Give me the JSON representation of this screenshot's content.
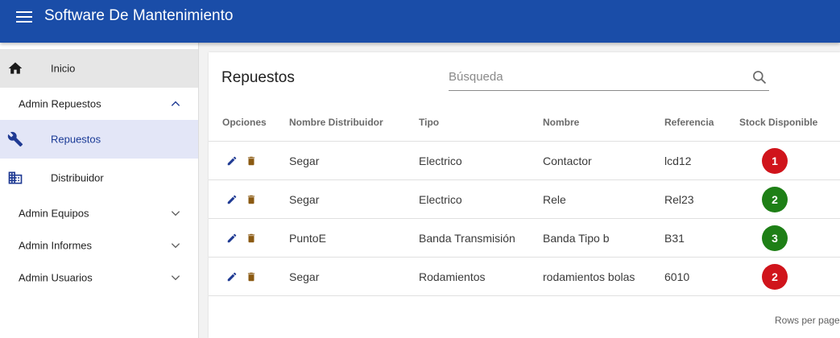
{
  "app": {
    "title": "Software De Mantenimiento"
  },
  "sidebar": {
    "inicio": "Inicio",
    "admin_repuestos": "Admin Repuestos",
    "repuestos": "Repuestos",
    "distribuidor": "Distribuidor",
    "admin_equipos": "Admin Equipos",
    "admin_informes": "Admin Informes",
    "admin_usuarios": "Admin Usuarios"
  },
  "main": {
    "title": "Repuestos",
    "search_placeholder": "Búsqueda"
  },
  "table": {
    "headers": {
      "opciones": "Opciones",
      "distribuidor": "Nombre Distribuidor",
      "tipo": "Tipo",
      "nombre": "Nombre",
      "referencia": "Referencia",
      "stock": "Stock Disponible"
    },
    "rows": [
      {
        "distribuidor": "Segar",
        "tipo": "Electrico",
        "nombre": "Contactor",
        "referencia": "lcd12",
        "stock": "1",
        "stock_color": "#d0141b"
      },
      {
        "distribuidor": "Segar",
        "tipo": "Electrico",
        "nombre": "Rele",
        "referencia": "Rel23",
        "stock": "2",
        "stock_color": "#1e7f16"
      },
      {
        "distribuidor": "PuntoE",
        "tipo": "Banda Transmisión",
        "nombre": "Banda Tipo b",
        "referencia": "B31",
        "stock": "3",
        "stock_color": "#1e7f16"
      },
      {
        "distribuidor": "Segar",
        "tipo": "Rodamientos",
        "nombre": "rodamientos bolas",
        "referencia": "6010",
        "stock": "2",
        "stock_color": "#d0141b"
      }
    ]
  },
  "pagination": {
    "rows_per_page": "Rows per page:"
  },
  "colors": {
    "appbar": "#1a4da8",
    "nav_active_bg": "#e3e6f7",
    "nav_active_text": "#1a3a96",
    "edit_icon": "#1f3a93",
    "delete_icon": "#8b5a12"
  },
  "icons": {
    "menu": "menu-icon",
    "home": "home-icon",
    "wrench": "wrench-icon",
    "building": "business-icon",
    "chevron_up": "chevron-up-icon",
    "chevron_down": "chevron-down-icon",
    "search": "search-icon",
    "edit": "edit-icon",
    "delete": "delete-icon"
  }
}
